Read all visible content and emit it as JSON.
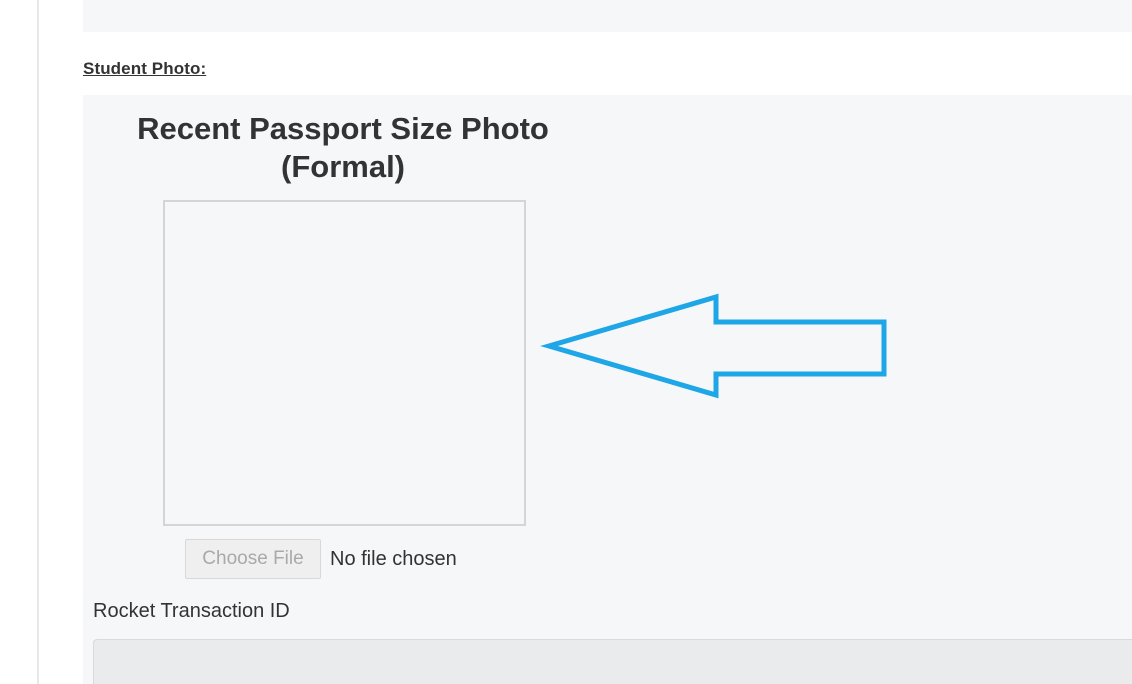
{
  "form": {
    "section_title": "Student Photo:",
    "photo": {
      "heading_line1": "Recent Passport Size Photo",
      "heading_line2": "(Formal)",
      "file_button_label": "Choose File",
      "file_status": "No file chosen"
    },
    "rocket_transaction": {
      "label": "Rocket Transaction ID",
      "value": "",
      "placeholder": ""
    }
  },
  "icons": {
    "annotation_arrow": "arrow-left-icon"
  },
  "colors": {
    "arrow": "#1ea6e6",
    "panel_background": "#f5f7f9",
    "input_background": "#e9ebed",
    "text": "#333333"
  }
}
